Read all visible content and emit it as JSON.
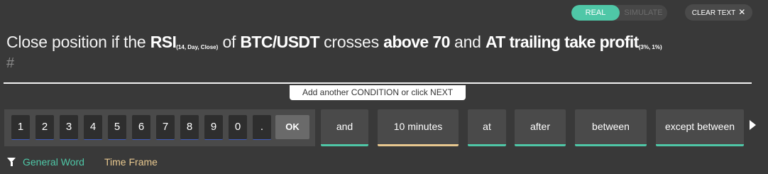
{
  "mode_toggle": {
    "real_label": "REAL",
    "simulate_label": "SIMULATE",
    "selected": "REAL"
  },
  "clear_button": {
    "label": "CLEAR TEXT",
    "icon": "close-icon"
  },
  "sentence": {
    "part1": "Close position if the ",
    "indicator": "RSI",
    "indicator_params": "(14, Day, Close)",
    "part2": " of ",
    "pair": "BTC/USDT",
    "part3": " crosses ",
    "condition": "above 70",
    "part4": " and ",
    "action": "AT trailing take profit",
    "action_params": "(3%, 1%)",
    "cursor_placeholder": "#"
  },
  "hint": "Add another CONDITION or click NEXT",
  "numpad": {
    "keys": [
      "1",
      "2",
      "3",
      "4",
      "5",
      "6",
      "7",
      "8",
      "9",
      "0",
      "."
    ],
    "ok_label": "OK"
  },
  "chips": [
    {
      "label": "and",
      "type": "general"
    },
    {
      "label": "10 minutes",
      "type": "time"
    },
    {
      "label": "at",
      "type": "general"
    },
    {
      "label": "after",
      "type": "general"
    },
    {
      "label": "between",
      "type": "general"
    },
    {
      "label": "except between",
      "type": "general"
    }
  ],
  "legend": {
    "general_label": "General Word",
    "time_label": "Time Frame",
    "general_color": "#4fc7a7",
    "time_color": "#e8c88f"
  },
  "colors": {
    "accent": "#4fc7a7",
    "time_accent": "#e8c88f",
    "background": "#393939"
  }
}
